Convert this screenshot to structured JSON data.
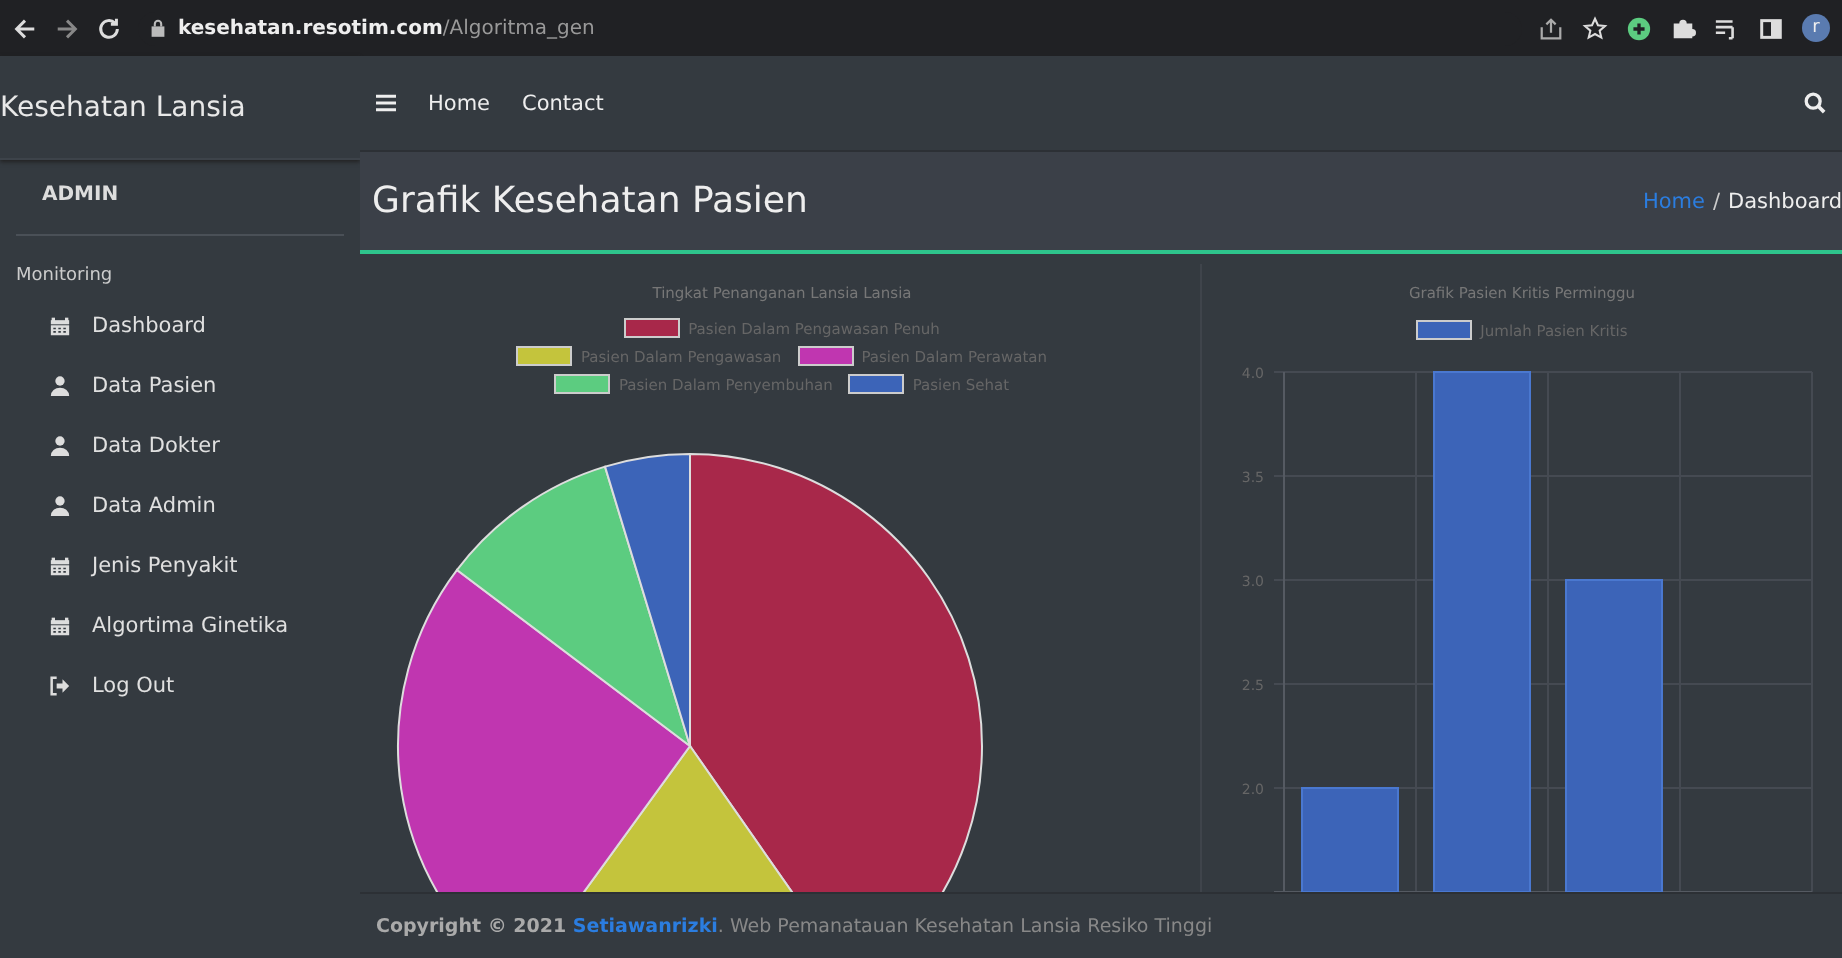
{
  "browser": {
    "url_host": "kesehatan.resotim.com",
    "url_path": "/Algoritma_gen",
    "profile_letter": "r"
  },
  "sidebar": {
    "brand": "Kesehatan Lansia",
    "user": "ADMIN",
    "section": "Monitoring",
    "items": [
      {
        "label": "Dashboard",
        "kind": "calendar"
      },
      {
        "label": "Data Pasien",
        "kind": "user"
      },
      {
        "label": "Data Dokter",
        "kind": "user"
      },
      {
        "label": "Data Admin",
        "kind": "user"
      },
      {
        "label": "Jenis Penyakit",
        "kind": "calendar"
      },
      {
        "label": "Algortima Ginetika",
        "kind": "calendar"
      },
      {
        "label": "Log Out",
        "kind": "logout"
      }
    ]
  },
  "navbar": {
    "links": [
      "Home",
      "Contact"
    ]
  },
  "header": {
    "title": "Grafik Kesehatan Pasien",
    "breadcrumb": [
      {
        "label": "Home",
        "kind": "link"
      },
      {
        "label": "Dashboard",
        "kind": "current"
      }
    ],
    "separator": "/"
  },
  "pie_chart": {
    "title": "Tingkat Penanganan Lansia Lansia",
    "legend": [
      {
        "label": "Pasien Dalam Pengawasan Penuh",
        "color": "#a8284a"
      },
      {
        "label": "Pasien Dalam Pengawasan",
        "color": "#c4c43c"
      },
      {
        "label": "Pasien Dalam Perawatan",
        "color": "#c036b0"
      },
      {
        "label": "Pasien Dalam Penyembuhan",
        "color": "#5ccc80"
      },
      {
        "label": "Pasien Sehat",
        "color": "#3c64b8"
      }
    ]
  },
  "bar_chart": {
    "chart_data": {
      "type": "bar",
      "title": "Grafik Pasien Kritis Perminggu",
      "series": [
        {
          "name": "Jumlah Pasien Kritis",
          "color": "#3c64b8",
          "values": [
            2,
            4,
            3,
            null
          ]
        }
      ],
      "grid": true,
      "ylim": [
        1.5,
        4
      ],
      "yticks": [
        {
          "value": 2,
          "label": "2.0"
        },
        {
          "value": 2.5,
          "label": "2.5"
        },
        {
          "value": 3,
          "label": "3.0"
        },
        {
          "value": 3.5,
          "label": "3.5"
        },
        {
          "value": 4,
          "label": "4.0"
        }
      ]
    }
  },
  "footer": {
    "prefix": "Copyright © 2021",
    "author": "Setiawanrizki",
    "suffix": ". Web Pemanatauan Kesehatan Lansia Resiko Tinggi"
  }
}
